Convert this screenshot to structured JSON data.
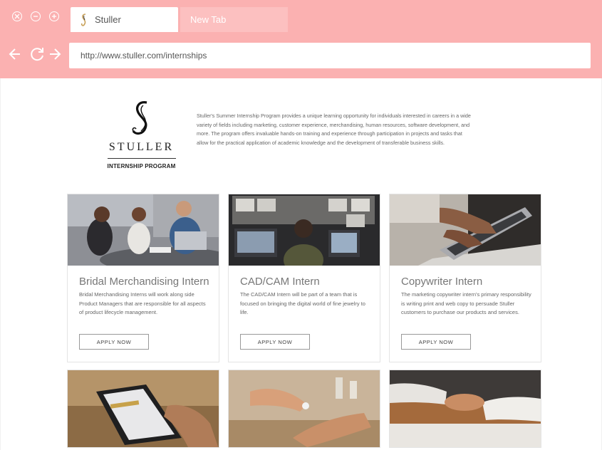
{
  "browser": {
    "tabs": [
      {
        "label": "Stuller",
        "active": true
      },
      {
        "label": "New Tab",
        "active": false
      }
    ],
    "address": "http://www.stuller.com/internships",
    "chrome_color": "#fbb1b1"
  },
  "header": {
    "logo_word": "STULLER",
    "logo_subtitle": "INTERNSHIP PROGRAM",
    "intro": "Stuller's Summer Internship Program provides a unique learning opportunity for individuals interested in careers in a wide variety of fields including marketing, customer experience, merchandising, human resources, software development, and more. The program offers invaluable hands-on training and experience through participation in projects and tasks that allow for the practical application of academic knowledge and the development of transferable business skills."
  },
  "internships": [
    {
      "title": "Bridal Merchandising Intern",
      "description": "Bridal Merchandising Interns will work along side Product Managers that are responsible for all aspects of product lifecycle management.",
      "button": "APPLY NOW",
      "image": "office-meeting-photo"
    },
    {
      "title": "CAD/CAM Intern",
      "description": "The CAD/CAM Intern will be part of a team that is focused on bringing the digital world of fine jewelry to life.",
      "button": "APPLY NOW",
      "image": "cad-workstation-photo"
    },
    {
      "title": "Copywriter Intern",
      "description": "The marketing copywriter intern's primary responsibility is writing print and web copy to persuade Stuller customers to purchase our products and services.",
      "button": "APPLY NOW",
      "image": "laptop-typing-photo"
    }
  ],
  "more_images": [
    "tablet-photo",
    "jewelry-handoff-photo",
    "handshake-photo"
  ]
}
